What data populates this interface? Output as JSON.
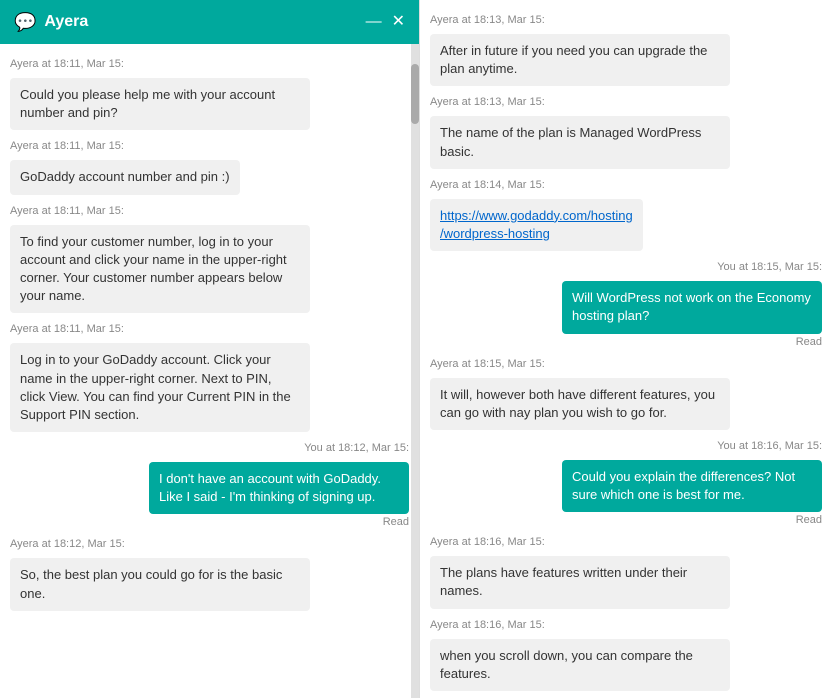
{
  "header": {
    "title": "Ayera",
    "icon": "💬",
    "minimize_label": "—",
    "close_label": "✕"
  },
  "left_messages": [
    {
      "type": "agent-timestamp",
      "text": "Ayera at 18:11, Mar 15:"
    },
    {
      "type": "agent",
      "text": "Could you please help me with your account number and pin?"
    },
    {
      "type": "agent-timestamp",
      "text": "Ayera at 18:11, Mar 15:"
    },
    {
      "type": "agent",
      "text": "GoDaddy account number and pin :)"
    },
    {
      "type": "agent-timestamp",
      "text": "Ayera at 18:11, Mar 15:"
    },
    {
      "type": "agent",
      "text": "To find your customer number, log in to your account and click your name in the upper-right corner. Your customer number appears below your name."
    },
    {
      "type": "agent-timestamp",
      "text": "Ayera at 18:11, Mar 15:"
    },
    {
      "type": "agent",
      "text": "Log in to your GoDaddy account. Click your name in the upper-right corner. Next to PIN, click View. You can find your Current PIN in the Support PIN section."
    },
    {
      "type": "user-timestamp",
      "text": "You at 18:12, Mar 15:"
    },
    {
      "type": "user",
      "text": "I don't have an account with GoDaddy. Like I said - I'm thinking of signing up.",
      "read": "Read"
    },
    {
      "type": "agent-timestamp",
      "text": "Ayera at 18:12, Mar 15:"
    },
    {
      "type": "agent",
      "text": "So, the best plan you could go for is the basic one."
    }
  ],
  "right_messages": [
    {
      "type": "agent-timestamp",
      "text": "Ayera at 18:13, Mar 15:"
    },
    {
      "type": "agent",
      "text": "After in future if you need you can upgrade the plan anytime."
    },
    {
      "type": "agent-timestamp",
      "text": "Ayera at 18:13, Mar 15:"
    },
    {
      "type": "agent",
      "text": "The name of the plan is Managed WordPress basic."
    },
    {
      "type": "agent-timestamp",
      "text": "Ayera at 18:14, Mar 15:"
    },
    {
      "type": "agent-link",
      "text": "https://www.godaddy.com/hosting/wordpress-hosting"
    },
    {
      "type": "user-timestamp",
      "text": "You at 18:15, Mar 15:"
    },
    {
      "type": "user",
      "text": "Will WordPress not work on the Economy hosting plan?",
      "read": "Read"
    },
    {
      "type": "agent-timestamp",
      "text": "Ayera at 18:15, Mar 15:"
    },
    {
      "type": "agent",
      "text": "It will, however both have different features, you can go with nay plan you wish to go for."
    },
    {
      "type": "user-timestamp",
      "text": "You at 18:16, Mar 15:"
    },
    {
      "type": "user",
      "text": "Could you explain the differences? Not sure which one is best for me.",
      "read": "Read"
    },
    {
      "type": "agent-timestamp",
      "text": "Ayera at 18:16, Mar 15:"
    },
    {
      "type": "agent",
      "text": "The plans have features written under their names."
    },
    {
      "type": "agent-timestamp",
      "text": "Ayera at 18:16, Mar 15:"
    },
    {
      "type": "agent",
      "text": "when you scroll down, you can compare the features."
    }
  ]
}
